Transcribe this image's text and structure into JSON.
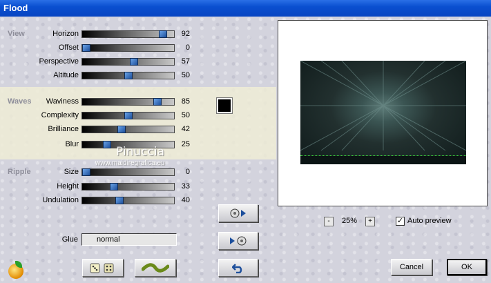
{
  "window": {
    "title": "Flood"
  },
  "sections": {
    "view": "View",
    "waves": "Waves",
    "ripple": "Ripple"
  },
  "params": [
    {
      "label": "Horizon",
      "value": "92",
      "level": 0.92
    },
    {
      "label": "Offset",
      "value": "0",
      "level": 0.0
    },
    {
      "label": "Perspective",
      "value": "57",
      "level": 0.57
    },
    {
      "label": "Altitude",
      "value": "50",
      "level": 0.5
    },
    {
      "label": "Waviness",
      "value": "85",
      "level": 0.85
    },
    {
      "label": "Complexity",
      "value": "50",
      "level": 0.5
    },
    {
      "label": "Brilliance",
      "value": "42",
      "level": 0.42
    },
    {
      "label": "Blur",
      "value": "25",
      "level": 0.25
    },
    {
      "label": "Size",
      "value": "0",
      "level": 0.0
    },
    {
      "label": "Height",
      "value": "33",
      "level": 0.33
    },
    {
      "label": "Undulation",
      "value": "40",
      "level": 0.4
    }
  ],
  "color": {
    "swatch": "#000000"
  },
  "preview": {
    "zoom": "25%",
    "zoom_out": "-",
    "zoom_in": "+",
    "auto_preview_label": "Auto preview",
    "auto_preview_checked": true,
    "check_mark": "✓"
  },
  "glue": {
    "label": "Glue",
    "value": "normal"
  },
  "buttons": {
    "cancel": "Cancel",
    "ok": "OK"
  },
  "watermark": {
    "name": "Pinuccia",
    "site": "www.maidiregrafica.eu"
  },
  "colors": {
    "titlebar": "#0a4fd0",
    "waves_band": "#eeecd6",
    "slider_handle": "#1d4f9c"
  }
}
